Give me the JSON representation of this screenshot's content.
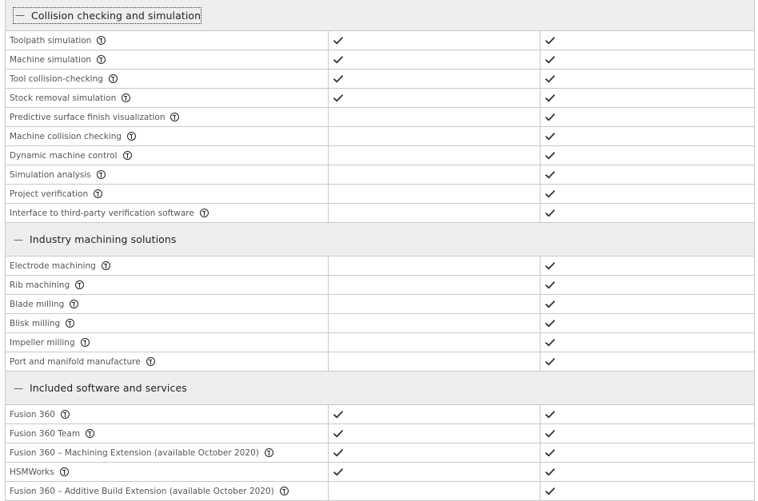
{
  "sections": [
    {
      "title": "Collision checking and simulation",
      "rows": [
        {
          "label": "Toolpath simulation",
          "c1": true,
          "c2": true
        },
        {
          "label": "Machine simulation",
          "c1": true,
          "c2": true
        },
        {
          "label": "Tool collision-checking",
          "c1": true,
          "c2": true
        },
        {
          "label": "Stock removal simulation",
          "c1": true,
          "c2": true
        },
        {
          "label": "Predictive surface finish visualization",
          "c1": false,
          "c2": true
        },
        {
          "label": "Machine collision checking",
          "c1": false,
          "c2": true
        },
        {
          "label": "Dynamic machine control",
          "c1": false,
          "c2": true
        },
        {
          "label": "Simulation analysis",
          "c1": false,
          "c2": true
        },
        {
          "label": "Project verification",
          "c1": false,
          "c2": true
        },
        {
          "label": "Interface to third-party verification software",
          "c1": false,
          "c2": true
        }
      ]
    },
    {
      "title": "Industry machining solutions",
      "rows": [
        {
          "label": "Electrode machining",
          "c1": false,
          "c2": true
        },
        {
          "label": "Rib machining",
          "c1": false,
          "c2": true
        },
        {
          "label": "Blade milling",
          "c1": false,
          "c2": true
        },
        {
          "label": "Blisk milling",
          "c1": false,
          "c2": true
        },
        {
          "label": "Impeller milling",
          "c1": false,
          "c2": true
        },
        {
          "label": "Port and manifold manufacture",
          "c1": false,
          "c2": true
        }
      ]
    },
    {
      "title": "Included software and services",
      "rows": [
        {
          "label": "Fusion 360",
          "c1": true,
          "c2": true
        },
        {
          "label": "Fusion 360 Team",
          "c1": true,
          "c2": true
        },
        {
          "label": "Fusion 360 – Machining Extension (available October 2020)",
          "c1": true,
          "c2": true
        },
        {
          "label": "HSMWorks",
          "c1": true,
          "c2": true
        },
        {
          "label": "Fusion 360 – Additive Build Extension (available October 2020)",
          "c1": false,
          "c2": true
        }
      ]
    }
  ],
  "icons": {
    "toggle": "minus-icon",
    "info": "info-icon",
    "check": "check-icon"
  }
}
